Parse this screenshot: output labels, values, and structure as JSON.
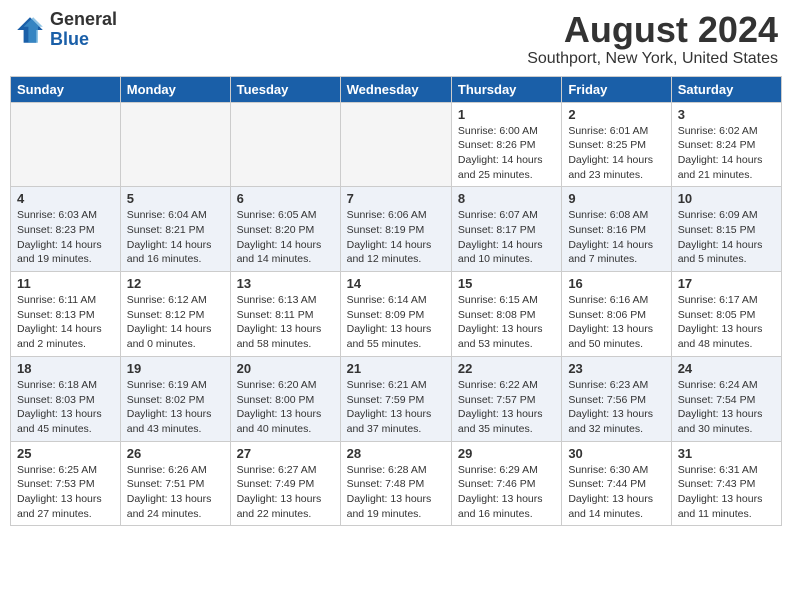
{
  "header": {
    "logo_general": "General",
    "logo_blue": "Blue",
    "month": "August 2024",
    "location": "Southport, New York, United States"
  },
  "weekdays": [
    "Sunday",
    "Monday",
    "Tuesday",
    "Wednesday",
    "Thursday",
    "Friday",
    "Saturday"
  ],
  "weeks": [
    [
      {
        "day": "",
        "info": ""
      },
      {
        "day": "",
        "info": ""
      },
      {
        "day": "",
        "info": ""
      },
      {
        "day": "",
        "info": ""
      },
      {
        "day": "1",
        "info": "Sunrise: 6:00 AM\nSunset: 8:26 PM\nDaylight: 14 hours\nand 25 minutes."
      },
      {
        "day": "2",
        "info": "Sunrise: 6:01 AM\nSunset: 8:25 PM\nDaylight: 14 hours\nand 23 minutes."
      },
      {
        "day": "3",
        "info": "Sunrise: 6:02 AM\nSunset: 8:24 PM\nDaylight: 14 hours\nand 21 minutes."
      }
    ],
    [
      {
        "day": "4",
        "info": "Sunrise: 6:03 AM\nSunset: 8:23 PM\nDaylight: 14 hours\nand 19 minutes."
      },
      {
        "day": "5",
        "info": "Sunrise: 6:04 AM\nSunset: 8:21 PM\nDaylight: 14 hours\nand 16 minutes."
      },
      {
        "day": "6",
        "info": "Sunrise: 6:05 AM\nSunset: 8:20 PM\nDaylight: 14 hours\nand 14 minutes."
      },
      {
        "day": "7",
        "info": "Sunrise: 6:06 AM\nSunset: 8:19 PM\nDaylight: 14 hours\nand 12 minutes."
      },
      {
        "day": "8",
        "info": "Sunrise: 6:07 AM\nSunset: 8:17 PM\nDaylight: 14 hours\nand 10 minutes."
      },
      {
        "day": "9",
        "info": "Sunrise: 6:08 AM\nSunset: 8:16 PM\nDaylight: 14 hours\nand 7 minutes."
      },
      {
        "day": "10",
        "info": "Sunrise: 6:09 AM\nSunset: 8:15 PM\nDaylight: 14 hours\nand 5 minutes."
      }
    ],
    [
      {
        "day": "11",
        "info": "Sunrise: 6:11 AM\nSunset: 8:13 PM\nDaylight: 14 hours\nand 2 minutes."
      },
      {
        "day": "12",
        "info": "Sunrise: 6:12 AM\nSunset: 8:12 PM\nDaylight: 14 hours\nand 0 minutes."
      },
      {
        "day": "13",
        "info": "Sunrise: 6:13 AM\nSunset: 8:11 PM\nDaylight: 13 hours\nand 58 minutes."
      },
      {
        "day": "14",
        "info": "Sunrise: 6:14 AM\nSunset: 8:09 PM\nDaylight: 13 hours\nand 55 minutes."
      },
      {
        "day": "15",
        "info": "Sunrise: 6:15 AM\nSunset: 8:08 PM\nDaylight: 13 hours\nand 53 minutes."
      },
      {
        "day": "16",
        "info": "Sunrise: 6:16 AM\nSunset: 8:06 PM\nDaylight: 13 hours\nand 50 minutes."
      },
      {
        "day": "17",
        "info": "Sunrise: 6:17 AM\nSunset: 8:05 PM\nDaylight: 13 hours\nand 48 minutes."
      }
    ],
    [
      {
        "day": "18",
        "info": "Sunrise: 6:18 AM\nSunset: 8:03 PM\nDaylight: 13 hours\nand 45 minutes."
      },
      {
        "day": "19",
        "info": "Sunrise: 6:19 AM\nSunset: 8:02 PM\nDaylight: 13 hours\nand 43 minutes."
      },
      {
        "day": "20",
        "info": "Sunrise: 6:20 AM\nSunset: 8:00 PM\nDaylight: 13 hours\nand 40 minutes."
      },
      {
        "day": "21",
        "info": "Sunrise: 6:21 AM\nSunset: 7:59 PM\nDaylight: 13 hours\nand 37 minutes."
      },
      {
        "day": "22",
        "info": "Sunrise: 6:22 AM\nSunset: 7:57 PM\nDaylight: 13 hours\nand 35 minutes."
      },
      {
        "day": "23",
        "info": "Sunrise: 6:23 AM\nSunset: 7:56 PM\nDaylight: 13 hours\nand 32 minutes."
      },
      {
        "day": "24",
        "info": "Sunrise: 6:24 AM\nSunset: 7:54 PM\nDaylight: 13 hours\nand 30 minutes."
      }
    ],
    [
      {
        "day": "25",
        "info": "Sunrise: 6:25 AM\nSunset: 7:53 PM\nDaylight: 13 hours\nand 27 minutes."
      },
      {
        "day": "26",
        "info": "Sunrise: 6:26 AM\nSunset: 7:51 PM\nDaylight: 13 hours\nand 24 minutes."
      },
      {
        "day": "27",
        "info": "Sunrise: 6:27 AM\nSunset: 7:49 PM\nDaylight: 13 hours\nand 22 minutes."
      },
      {
        "day": "28",
        "info": "Sunrise: 6:28 AM\nSunset: 7:48 PM\nDaylight: 13 hours\nand 19 minutes."
      },
      {
        "day": "29",
        "info": "Sunrise: 6:29 AM\nSunset: 7:46 PM\nDaylight: 13 hours\nand 16 minutes."
      },
      {
        "day": "30",
        "info": "Sunrise: 6:30 AM\nSunset: 7:44 PM\nDaylight: 13 hours\nand 14 minutes."
      },
      {
        "day": "31",
        "info": "Sunrise: 6:31 AM\nSunset: 7:43 PM\nDaylight: 13 hours\nand 11 minutes."
      }
    ]
  ]
}
